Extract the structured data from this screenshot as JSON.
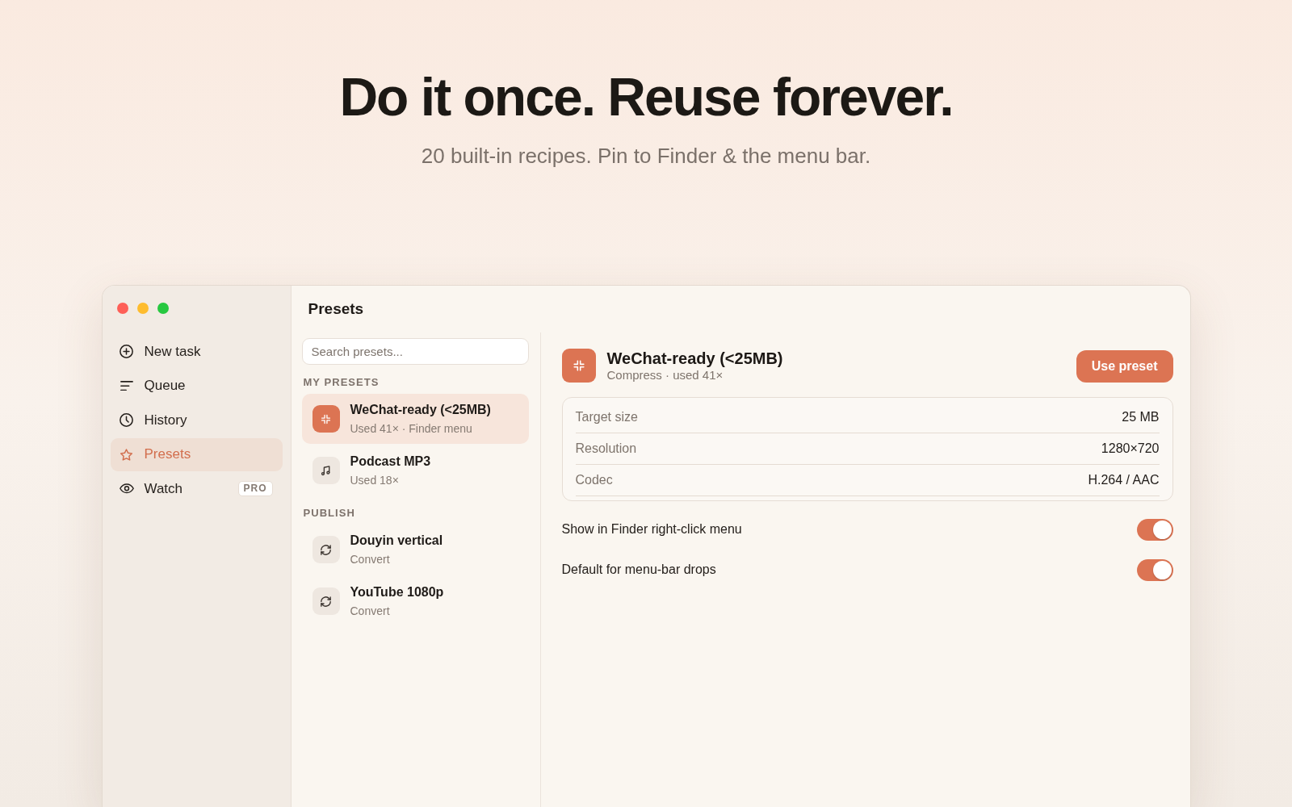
{
  "hero": {
    "title": "Do it once. Reuse forever.",
    "subtitle": "20 built-in recipes. Pin to Finder & the menu bar."
  },
  "sidebar": {
    "items": [
      {
        "label": "New task",
        "selected": false
      },
      {
        "label": "Queue",
        "selected": false
      },
      {
        "label": "History",
        "selected": false
      },
      {
        "label": "Presets",
        "selected": true
      },
      {
        "label": "Watch",
        "selected": false,
        "badge": "PRO"
      }
    ]
  },
  "presets_pane": {
    "title": "Presets",
    "search": {
      "placeholder": "Search presets..."
    },
    "groups": [
      {
        "heading": "MY PRESETS",
        "items": [
          {
            "kind": "compress",
            "name": "WeChat-ready (<25MB)",
            "detail": "Used 41× · Finder menu",
            "selected": true
          },
          {
            "kind": "audio",
            "name": "Podcast MP3",
            "detail": "Used 18×",
            "selected": false
          }
        ]
      },
      {
        "heading": "PUBLISH",
        "items": [
          {
            "kind": "convert",
            "name": "Douyin vertical",
            "detail": "Convert",
            "selected": false
          },
          {
            "kind": "convert",
            "name": "YouTube 1080p",
            "detail": "Convert",
            "selected": false
          }
        ]
      }
    ]
  },
  "detail": {
    "kind": "compress",
    "title": "WeChat-ready (<25MB)",
    "subtitle": "Compress · used 41×",
    "button": "Use preset",
    "settings": [
      {
        "label": "Target size",
        "value": "25 MB"
      },
      {
        "label": "Resolution",
        "value": "1280×720"
      },
      {
        "label": "Codec",
        "value": "H.264 / AAC"
      }
    ],
    "toggles": [
      {
        "label": "Show in Finder right-click menu",
        "on": true
      },
      {
        "label": "Default for menu-bar drops",
        "on": true
      }
    ]
  }
}
